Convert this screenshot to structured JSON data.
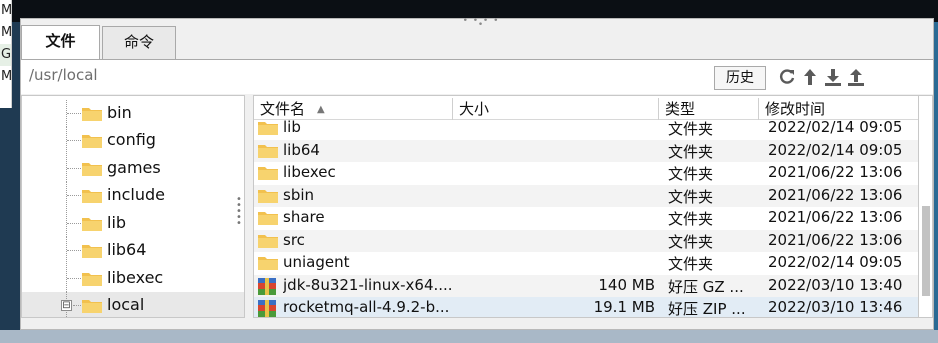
{
  "background": {
    "left_strip_letters": [
      "M",
      "M",
      "G",
      "M"
    ]
  },
  "tabs": [
    {
      "label": "文件",
      "active": true
    },
    {
      "label": "命令",
      "active": false
    }
  ],
  "pathbar": {
    "path": "/usr/local",
    "history_button": "历史",
    "tool_icons": [
      "refresh-icon",
      "upload-arrow-icon",
      "download-icon",
      "upload-icon"
    ]
  },
  "tree": {
    "items": [
      {
        "label": "bin",
        "selected": false
      },
      {
        "label": "config",
        "selected": false
      },
      {
        "label": "games",
        "selected": false
      },
      {
        "label": "include",
        "selected": false
      },
      {
        "label": "lib",
        "selected": false
      },
      {
        "label": "lib64",
        "selected": false
      },
      {
        "label": "libexec",
        "selected": false
      },
      {
        "label": "local",
        "selected": true,
        "expandable": true,
        "expander": "⊟"
      }
    ]
  },
  "filelist": {
    "columns": {
      "name": "文件名",
      "size": "大小",
      "type": "类型",
      "modified": "修改时间"
    },
    "rows": [
      {
        "icon": "folder-icon",
        "name": "lib",
        "size": "",
        "type": "文件夹",
        "modified": "2022/02/14 09:05"
      },
      {
        "icon": "folder-icon",
        "name": "lib64",
        "size": "",
        "type": "文件夹",
        "modified": "2022/02/14 09:05"
      },
      {
        "icon": "folder-icon",
        "name": "libexec",
        "size": "",
        "type": "文件夹",
        "modified": "2021/06/22 13:06"
      },
      {
        "icon": "folder-icon",
        "name": "sbin",
        "size": "",
        "type": "文件夹",
        "modified": "2021/06/22 13:06"
      },
      {
        "icon": "folder-icon",
        "name": "share",
        "size": "",
        "type": "文件夹",
        "modified": "2021/06/22 13:06"
      },
      {
        "icon": "folder-icon",
        "name": "src",
        "size": "",
        "type": "文件夹",
        "modified": "2021/06/22 13:06"
      },
      {
        "icon": "folder-icon",
        "name": "uniagent",
        "size": "",
        "type": "文件夹",
        "modified": "2022/02/14 09:05"
      },
      {
        "icon": "archive-icon",
        "name": "jdk-8u321-linux-x64....",
        "size": "140 MB",
        "type": "好压 GZ ...",
        "modified": "2022/03/10 13:40"
      },
      {
        "icon": "archive-icon",
        "name": "rocketmq-all-4.9.2-b...",
        "size": "19.1 MB",
        "type": "好压 ZIP ...",
        "modified": "2022/03/10 13:46"
      }
    ]
  },
  "colors": {
    "folder": "#f2c14e",
    "selected_row": "#e2ecf5",
    "panel_bg": "#f0f0f0"
  }
}
